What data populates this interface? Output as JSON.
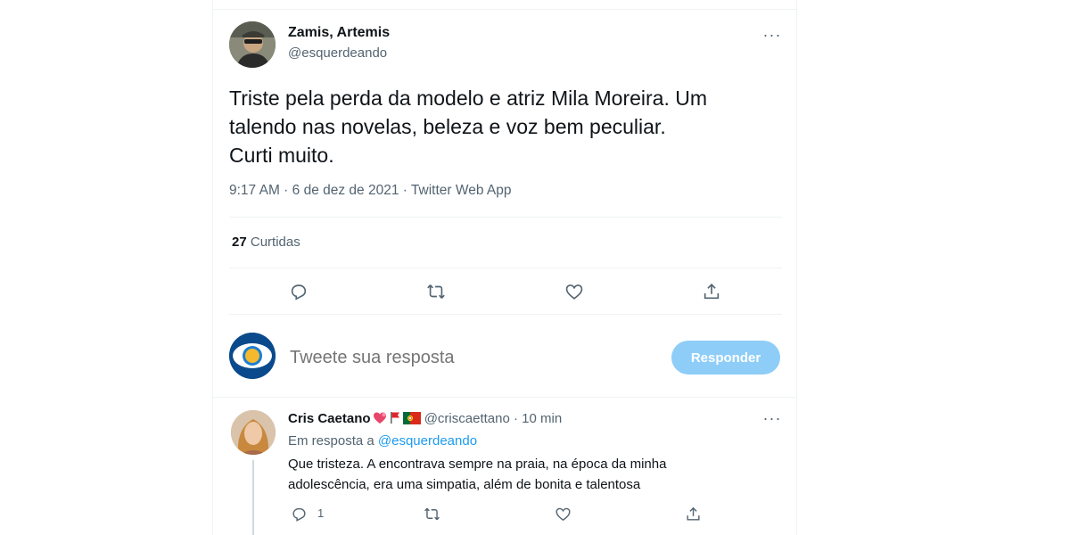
{
  "tweet": {
    "author_name": "Zamis, Artemis",
    "author_handle": "@esquerdeando",
    "text_lines": [
      "Triste pela perda da modelo e atriz Mila Moreira. Um",
      "talendo nas novelas, beleza e voz bem peculiar.",
      "Curti muito."
    ],
    "meta": "9:17 AM · 6 de dez de 2021 · Twitter Web App",
    "likes_count": "27",
    "likes_label": "Curtidas",
    "more_glyph": "···"
  },
  "compose": {
    "placeholder": "Tweete sua resposta",
    "button_label": "Responder"
  },
  "reply": {
    "name": "Cris Caetano",
    "handle": "@criscaettano",
    "separator": "·",
    "time": "10 min",
    "in_reply_prefix": "Em resposta a",
    "in_reply_handle": "@esquerdeando",
    "text_lines": [
      "Que tristeza. A encontrava sempre na praia, na época da minha",
      "adolescência, era uma simpatia, além de bonita e talentosa"
    ],
    "reply_count": "1",
    "more_glyph": "···"
  },
  "colors": {
    "accent": "#1d9bf0",
    "button_disabled": "#8ecdf8",
    "secondary_text": "#536471",
    "border": "#eff3f4"
  },
  "icons": [
    "reply-icon",
    "retweet-icon",
    "like-icon",
    "share-icon",
    "more-icon"
  ]
}
